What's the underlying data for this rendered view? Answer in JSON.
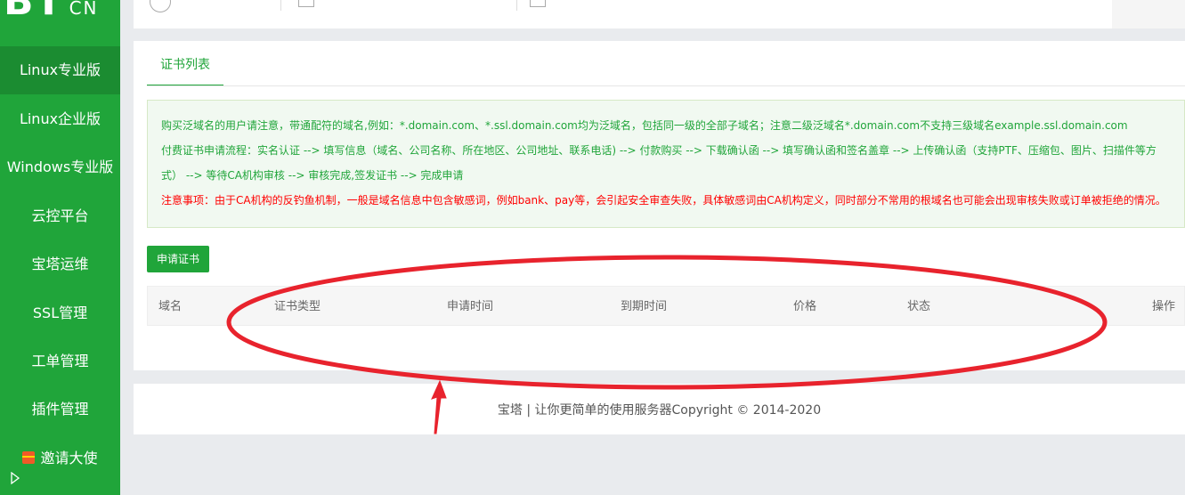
{
  "sidebar": {
    "logo_main": "BT",
    "logo_small": "CN",
    "items": [
      {
        "label": "Linux专业版"
      },
      {
        "label": "Linux企业版"
      },
      {
        "label": "Windows专业版"
      },
      {
        "label": "云控平台"
      },
      {
        "label": "宝塔运维"
      },
      {
        "label": "SSL管理"
      },
      {
        "label": "工单管理"
      },
      {
        "label": "插件管理"
      },
      {
        "label": "邀请大使"
      }
    ]
  },
  "tabs": {
    "active": "证书列表"
  },
  "notice": {
    "line1": "购买泛域名的用户请注意，带通配符的域名,例如：*.domain.com、*.ssl.domain.com均为泛域名，包括同一级的全部子域名；注意二级泛域名*.domain.com不支持三级域名example.ssl.domain.com",
    "line2": "付费证书申请流程：实名认证 --> 填写信息（域名、公司名称、所在地区、公司地址、联系电话) --> 付款购买 --> 下载确认函 --> 填写确认函和签名盖章 --> 上传确认函（支持PTF、压缩包、图片、扫描件等方式） --> 等待CA机构审核 --> 审核完成,签发证书 --> 完成申请",
    "warning": "注意事项：由于CA机构的反钓鱼机制，一般是域名信息中包含敏感词，例如bank、pay等，会引起安全审查失败，具体敏感词由CA机构定义，同时部分不常用的根域名也可能会出现审核失败或订单被拒绝的情况。"
  },
  "actions": {
    "apply_label": "申请证书"
  },
  "table": {
    "columns": [
      "域名",
      "证书类型",
      "申请时间",
      "到期时间",
      "价格",
      "状态",
      "操作"
    ]
  },
  "footer": {
    "text": "宝塔 | 让你更简单的使用服务器Copyright © 2014-2020"
  },
  "colors": {
    "brand_green": "#20a53a",
    "active_green": "#1b8c31",
    "warning_red": "#ff0000",
    "annotation_red": "#e8232d"
  }
}
